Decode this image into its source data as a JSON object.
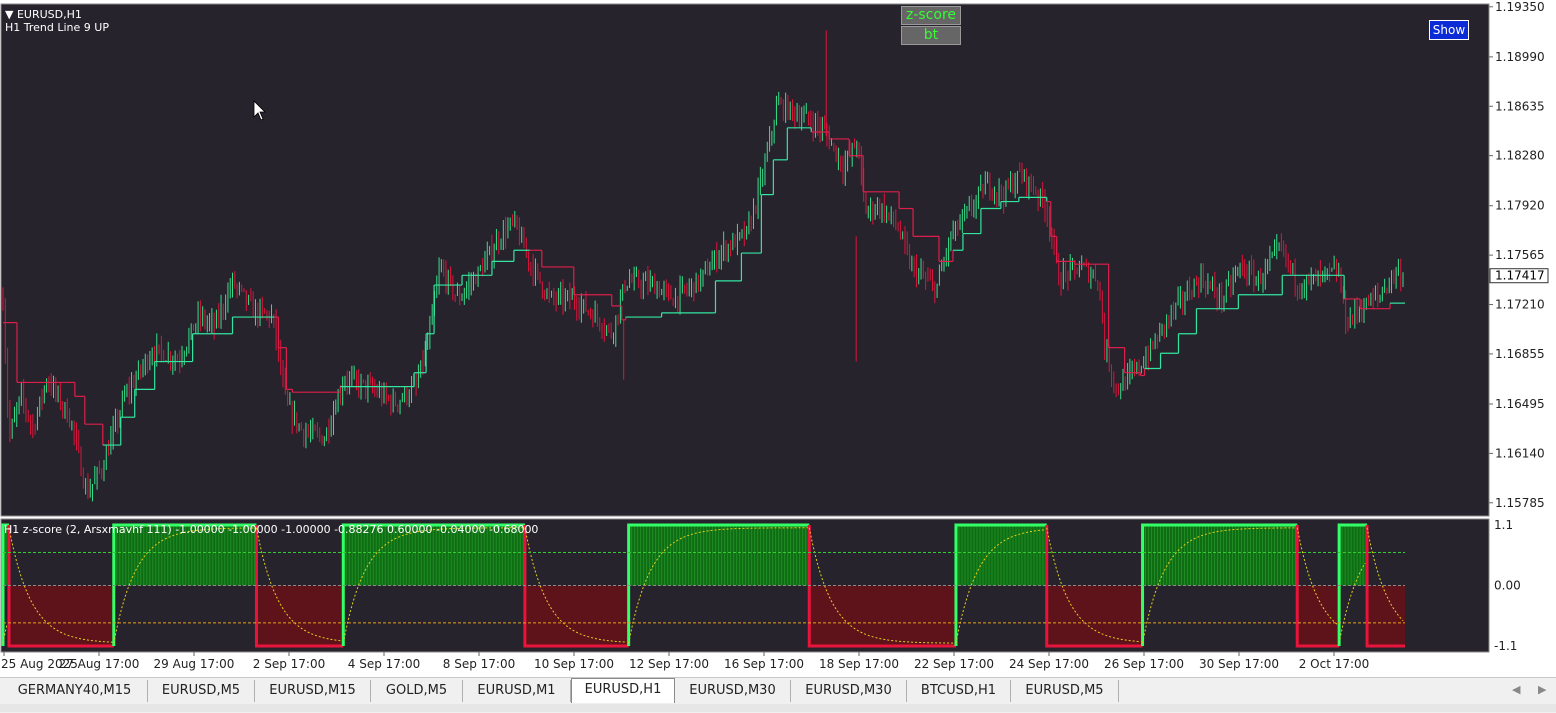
{
  "chart_window": {
    "symbol_label": "EURUSD,H1",
    "indicator_label": "H1 Trend Line 9 UP",
    "current_price": "1.17417",
    "buttons": {
      "zscore": "z-score",
      "bt": "bt",
      "show": "Show"
    }
  },
  "colors": {
    "background": "#27232c",
    "bull": "#35e08a",
    "bear": "#dc143c",
    "trend_up": "#32e6a0",
    "trend_down": "#dc1f4a",
    "grid": "#c8c8c8"
  },
  "price_axis": {
    "labels": [
      "1.19350",
      "1.18990",
      "1.18635",
      "1.18280",
      "1.17920",
      "1.17565",
      "1.17210",
      "1.16855",
      "1.16495",
      "1.16140",
      "1.15785"
    ],
    "range": [
      1.1569,
      1.1937
    ]
  },
  "time_axis": {
    "labels": [
      "25 Aug 2025",
      "27 Aug 17:00",
      "29 Aug 17:00",
      "2 Sep 17:00",
      "4 Sep 17:00",
      "8 Sep 17:00",
      "10 Sep 17:00",
      "12 Sep 17:00",
      "16 Sep 17:00",
      "18 Sep 17:00",
      "22 Sep 17:00",
      "24 Sep 17:00",
      "26 Sep 17:00",
      "30 Sep 17:00",
      "2 Oct 17:00"
    ]
  },
  "subwindow": {
    "label": "H1 z-score (2, Arsxmavhf 111) -1.00000 -1.00000 -1.00000 -0.88276 0.60000 -0.04000 -0.68000",
    "axis_labels": [
      "1.1",
      "0.00",
      "-1.1"
    ],
    "levels": [
      0.6,
      0.0,
      -0.68
    ]
  },
  "chart_data": [
    {
      "type": "candlestick",
      "series": [
        {
          "name": "EURUSD,H1"
        }
      ],
      "price_path": [
        [
          0,
          1.1725
        ],
        [
          6,
          1.1625
        ],
        [
          18,
          1.1655
        ],
        [
          30,
          1.1632
        ],
        [
          44,
          1.1668
        ],
        [
          68,
          1.1638
        ],
        [
          84,
          1.1585
        ],
        [
          100,
          1.1605
        ],
        [
          122,
          1.1655
        ],
        [
          150,
          1.1688
        ],
        [
          176,
          1.1682
        ],
        [
          196,
          1.1712
        ],
        [
          212,
          1.1705
        ],
        [
          230,
          1.1737
        ],
        [
          252,
          1.1716
        ],
        [
          270,
          1.1712
        ],
        [
          284,
          1.1648
        ],
        [
          300,
          1.163
        ],
        [
          322,
          1.1625
        ],
        [
          342,
          1.1668
        ],
        [
          370,
          1.166
        ],
        [
          392,
          1.165
        ],
        [
          414,
          1.1662
        ],
        [
          426,
          1.1695
        ],
        [
          438,
          1.1748
        ],
        [
          456,
          1.1725
        ],
        [
          478,
          1.1745
        ],
        [
          498,
          1.177
        ],
        [
          512,
          1.178
        ],
        [
          530,
          1.1748
        ],
        [
          548,
          1.1725
        ],
        [
          572,
          1.1725
        ],
        [
          595,
          1.1712
        ],
        [
          610,
          1.17
        ],
        [
          624,
          1.1738
        ],
        [
          652,
          1.1735
        ],
        [
          672,
          1.1725
        ],
        [
          698,
          1.1738
        ],
        [
          720,
          1.176
        ],
        [
          746,
          1.1772
        ],
        [
          760,
          1.181
        ],
        [
          776,
          1.1865
        ],
        [
          796,
          1.1858
        ],
        [
          812,
          1.1852
        ],
        [
          824,
          1.1845
        ],
        [
          842,
          1.182
        ],
        [
          856,
          1.1838
        ],
        [
          864,
          1.1788
        ],
        [
          878,
          1.1792
        ],
        [
          896,
          1.1778
        ],
        [
          910,
          1.1748
        ],
        [
          935,
          1.1732
        ],
        [
          950,
          1.177
        ],
        [
          968,
          1.1788
        ],
        [
          986,
          1.1808
        ],
        [
          1002,
          1.18
        ],
        [
          1020,
          1.1815
        ],
        [
          1036,
          1.1802
        ],
        [
          1046,
          1.179
        ],
        [
          1058,
          1.174
        ],
        [
          1080,
          1.1748
        ],
        [
          1098,
          1.174
        ],
        [
          1104,
          1.169
        ],
        [
          1116,
          1.166
        ],
        [
          1134,
          1.1672
        ],
        [
          1150,
          1.1688
        ],
        [
          1168,
          1.1712
        ],
        [
          1186,
          1.1728
        ],
        [
          1200,
          1.174
        ],
        [
          1222,
          1.1725
        ],
        [
          1240,
          1.1748
        ],
        [
          1258,
          1.1738
        ],
        [
          1280,
          1.1762
        ],
        [
          1298,
          1.1735
        ],
        [
          1320,
          1.174
        ],
        [
          1338,
          1.1745
        ],
        [
          1346,
          1.1708
        ],
        [
          1360,
          1.1718
        ],
        [
          1380,
          1.1728
        ],
        [
          1396,
          1.1745
        ],
        [
          1405,
          1.1741
        ]
      ],
      "trend_steps": [
        [
          0,
          1.1708,
          "down"
        ],
        [
          5,
          1.1708,
          "down"
        ],
        [
          14,
          1.1665,
          "down"
        ],
        [
          62,
          1.1665,
          "down"
        ],
        [
          72,
          1.1655,
          "down"
        ],
        [
          82,
          1.1635,
          "down"
        ],
        [
          100,
          1.162,
          "up"
        ],
        [
          118,
          1.164,
          "up"
        ],
        [
          132,
          1.166,
          "up"
        ],
        [
          152,
          1.168,
          "up"
        ],
        [
          190,
          1.17,
          "up"
        ],
        [
          230,
          1.1712,
          "up"
        ],
        [
          272,
          1.1712,
          "down"
        ],
        [
          276,
          1.169,
          "down"
        ],
        [
          284,
          1.166,
          "down"
        ],
        [
          290,
          1.1658,
          "down"
        ],
        [
          338,
          1.1662,
          "up"
        ],
        [
          398,
          1.1662,
          "up"
        ],
        [
          412,
          1.1672,
          "up"
        ],
        [
          424,
          1.17,
          "up"
        ],
        [
          432,
          1.1735,
          "up"
        ],
        [
          460,
          1.1742,
          "up"
        ],
        [
          490,
          1.1752,
          "up"
        ],
        [
          512,
          1.176,
          "up"
        ],
        [
          528,
          1.176,
          "down"
        ],
        [
          540,
          1.1748,
          "down"
        ],
        [
          572,
          1.1728,
          "down"
        ],
        [
          610,
          1.172,
          "down"
        ],
        [
          620,
          1.171,
          "down"
        ],
        [
          624,
          1.1712,
          "up"
        ],
        [
          660,
          1.1715,
          "up"
        ],
        [
          710,
          1.1715,
          "up"
        ],
        [
          714,
          1.1738,
          "up"
        ],
        [
          740,
          1.1758,
          "up"
        ],
        [
          760,
          1.18,
          "up"
        ],
        [
          772,
          1.1825,
          "up"
        ],
        [
          786,
          1.1848,
          "up"
        ],
        [
          806,
          1.1848,
          "up"
        ],
        [
          810,
          1.1845,
          "down"
        ],
        [
          828,
          1.184,
          "down"
        ],
        [
          848,
          1.1828,
          "down"
        ],
        [
          862,
          1.1802,
          "down"
        ],
        [
          898,
          1.179,
          "down"
        ],
        [
          912,
          1.177,
          "down"
        ],
        [
          938,
          1.1752,
          "down"
        ],
        [
          952,
          1.176,
          "up"
        ],
        [
          962,
          1.1772,
          "up"
        ],
        [
          980,
          1.179,
          "up"
        ],
        [
          1000,
          1.1795,
          "up"
        ],
        [
          1018,
          1.1798,
          "up"
        ],
        [
          1042,
          1.1798,
          "up"
        ],
        [
          1046,
          1.1795,
          "down"
        ],
        [
          1050,
          1.177,
          "down"
        ],
        [
          1056,
          1.1752,
          "down"
        ],
        [
          1074,
          1.175,
          "down"
        ],
        [
          1100,
          1.175,
          "down"
        ],
        [
          1108,
          1.169,
          "down"
        ],
        [
          1124,
          1.1672,
          "down"
        ],
        [
          1140,
          1.167,
          "down"
        ],
        [
          1144,
          1.1675,
          "up"
        ],
        [
          1160,
          1.1686,
          "up"
        ],
        [
          1178,
          1.17,
          "up"
        ],
        [
          1196,
          1.1718,
          "up"
        ],
        [
          1238,
          1.1728,
          "up"
        ],
        [
          1282,
          1.1742,
          "up"
        ],
        [
          1342,
          1.1742,
          "up"
        ],
        [
          1344,
          1.1725,
          "down"
        ],
        [
          1360,
          1.1718,
          "down"
        ],
        [
          1390,
          1.1722,
          "up"
        ],
        [
          1405,
          1.1722,
          "up"
        ]
      ],
      "wick_spikes": [
        [
          825,
          1.1918,
          1.1842
        ],
        [
          855,
          1.177,
          1.168
        ],
        [
          622,
          1.171,
          1.1667
        ]
      ]
    },
    {
      "type": "area",
      "series": [
        {
          "name": "z-score"
        }
      ],
      "segments": [
        [
          0,
          6,
          "up"
        ],
        [
          6,
          111,
          "down"
        ],
        [
          111,
          254,
          "up"
        ],
        [
          254,
          341,
          "down"
        ],
        [
          341,
          523,
          "up"
        ],
        [
          523,
          627,
          "down"
        ],
        [
          627,
          808,
          "up"
        ],
        [
          808,
          955,
          "down"
        ],
        [
          955,
          1046,
          "up"
        ],
        [
          1046,
          1142,
          "down"
        ],
        [
          1142,
          1297,
          "up"
        ],
        [
          1297,
          1339,
          "down"
        ],
        [
          1339,
          1367,
          "up"
        ],
        [
          1367,
          1405,
          "down"
        ]
      ],
      "ylim": [
        -1.1,
        1.1
      ]
    }
  ]
}
